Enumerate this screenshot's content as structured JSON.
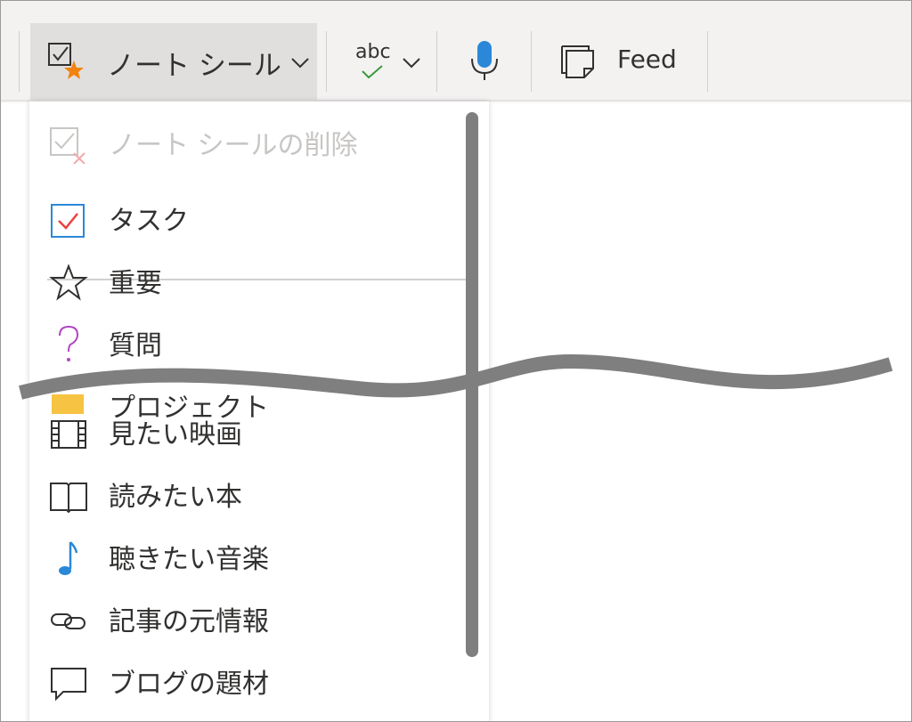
{
  "toolbar": {
    "tags_label": "ノート シール",
    "spell_label": "abc",
    "feed_label": "Feed"
  },
  "menu": {
    "remove_label": "ノート シールの削除",
    "items": [
      {
        "label": "タスク",
        "icon": "checkbox-icon"
      },
      {
        "label": "重要",
        "icon": "star-icon"
      },
      {
        "label": "質問",
        "icon": "question-icon"
      },
      {
        "label": "プロジェクト",
        "icon": "project-icon"
      },
      {
        "label": "見たい映画",
        "icon": "film-icon"
      },
      {
        "label": "読みたい本",
        "icon": "book-icon"
      },
      {
        "label": "聴きたい音楽",
        "icon": "music-note-icon"
      },
      {
        "label": "記事の元情報",
        "icon": "link-icon"
      },
      {
        "label": "ブログの題材",
        "icon": "speech-bubble-icon"
      }
    ]
  },
  "colors": {
    "accent_blue": "#2b88d8",
    "check_red": "#e8433f",
    "star_orange": "#f2820f",
    "question_purple": "#b146c2",
    "spell_green": "#3a9a3a",
    "mic_blue": "#2b88d8",
    "break_line": "#7f7f7f"
  }
}
